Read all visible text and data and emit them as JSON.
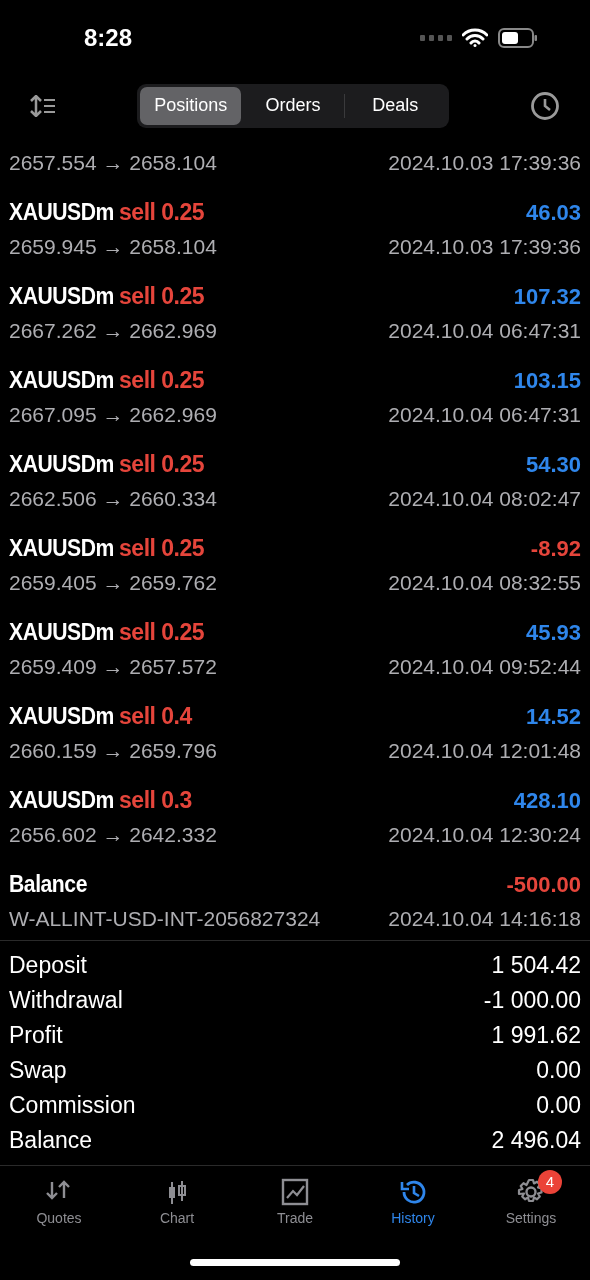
{
  "status_bar": {
    "time": "8:28"
  },
  "tabs": [
    {
      "label": "Positions",
      "selected": true
    },
    {
      "label": "Orders",
      "selected": false
    },
    {
      "label": "Deals",
      "selected": false
    }
  ],
  "partial_row": {
    "prices": "2657.554 → 2658.104",
    "time": "2024.10.03 17:39:36"
  },
  "rows": [
    {
      "kind": "trade",
      "symbol": "XAUUSDm",
      "action": "sell 0.25",
      "profit": "46.03",
      "color": "#2f86eb",
      "prices": "2659.945 → 2658.104",
      "time": "2024.10.03 17:39:36"
    },
    {
      "kind": "trade",
      "symbol": "XAUUSDm",
      "action": "sell 0.25",
      "profit": "107.32",
      "color": "#2f86eb",
      "prices": "2667.262 → 2662.969",
      "time": "2024.10.04 06:47:31"
    },
    {
      "kind": "trade",
      "symbol": "XAUUSDm",
      "action": "sell 0.25",
      "profit": "103.15",
      "color": "#2f86eb",
      "prices": "2667.095 → 2662.969",
      "time": "2024.10.04 06:47:31"
    },
    {
      "kind": "trade",
      "symbol": "XAUUSDm",
      "action": "sell 0.25",
      "profit": "54.30",
      "color": "#2f86eb",
      "prices": "2662.506 → 2660.334",
      "time": "2024.10.04 08:02:47"
    },
    {
      "kind": "trade",
      "symbol": "XAUUSDm",
      "action": "sell 0.25",
      "profit": "-8.92",
      "color": "#e5453b",
      "prices": "2659.405 → 2659.762",
      "time": "2024.10.04 08:32:55"
    },
    {
      "kind": "trade",
      "symbol": "XAUUSDm",
      "action": "sell 0.25",
      "profit": "45.93",
      "color": "#2f86eb",
      "prices": "2659.409 → 2657.572",
      "time": "2024.10.04 09:52:44"
    },
    {
      "kind": "trade",
      "symbol": "XAUUSDm",
      "action": "sell 0.4",
      "profit": "14.52",
      "color": "#2f86eb",
      "prices": "2660.159 → 2659.796",
      "time": "2024.10.04 12:01:48"
    },
    {
      "kind": "trade",
      "symbol": "XAUUSDm",
      "action": "sell 0.3",
      "profit": "428.10",
      "color": "#2f86eb",
      "prices": "2656.602 → 2642.332",
      "time": "2024.10.04 12:30:24"
    },
    {
      "kind": "balance",
      "symbol": "Balance",
      "profit": "-500.00",
      "color": "#e5453b",
      "prices": "W-ALLINT-USD-INT-2056827324",
      "time": "2024.10.04 14:16:18"
    }
  ],
  "summary": [
    {
      "label": "Deposit",
      "value": "1 504.42"
    },
    {
      "label": "Withdrawal",
      "value": "-1 000.00"
    },
    {
      "label": "Profit",
      "value": "1 991.62"
    },
    {
      "label": "Swap",
      "value": "0.00"
    },
    {
      "label": "Commission",
      "value": "0.00"
    },
    {
      "label": "Balance",
      "value": "2 496.04"
    }
  ],
  "nav": [
    {
      "label": "Quotes",
      "kind": "quotes",
      "selected": false
    },
    {
      "label": "Chart",
      "kind": "chart",
      "selected": false
    },
    {
      "label": "Trade",
      "kind": "trade",
      "selected": false
    },
    {
      "label": "History",
      "kind": "history",
      "selected": true
    },
    {
      "label": "Settings",
      "kind": "settings",
      "selected": false,
      "badge": "4"
    }
  ]
}
